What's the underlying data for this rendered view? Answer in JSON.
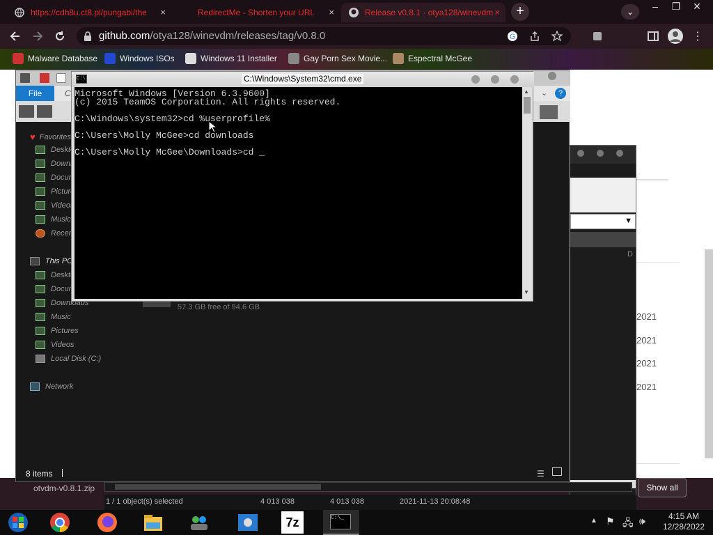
{
  "browser": {
    "tabs": [
      {
        "title": "https://cdh8u.ct8.pl/pungabi/the",
        "close": "×"
      },
      {
        "title": "RedirectMe - Shorten your URL",
        "close": "×"
      },
      {
        "title": "Release v0.8.1 · otya128/winevdm",
        "close": "×"
      }
    ],
    "new_tab": "+",
    "url_host": "github.com",
    "url_path": "/otya128/winevdm/releases/tag/v0.8.0",
    "bookmarks": [
      "Malware Database",
      "Windows ISOs",
      "Windows 11 Installer",
      "Gay Porn Sex Movie...",
      "Espectral McGee"
    ],
    "window_controls": [
      "–",
      "❐",
      "✕"
    ]
  },
  "explorer": {
    "file_tab": "File",
    "partial_tab": "C",
    "favorites_label": "Favorites",
    "favorites": [
      "Desktop",
      "Downloads",
      "Documents",
      "Pictures",
      "Videos",
      "Music",
      "Recent places"
    ],
    "this_pc_label": "This PC",
    "this_pc": [
      "Desktop",
      "Documents",
      "Downloads",
      "Music",
      "Pictures",
      "Videos",
      "Local Disk (C:)"
    ],
    "network_label": "Network",
    "disk_free": "57.3 GB free of 94.6 GB",
    "item_count": "8 items",
    "selection_status": "1 / 1 object(s) selected",
    "size1": "4 013 038",
    "size2": "4 013 038",
    "modified": "2021-11-13 20:08:48"
  },
  "page_fragments": {
    "years": [
      "2021",
      "2021",
      "2021",
      "2021"
    ],
    "show_all": "Show all",
    "download_file": "otvdm-v0.8.1.zip",
    "col_letter": "D"
  },
  "cmd": {
    "title": "C:\\Windows\\System32\\cmd.exe",
    "lines": [
      "Microsoft Windows [Version 6.3.9600]",
      "(c) 2015 TeamOS Corporation. All rights reserved.",
      "",
      "C:\\Windows\\system32>cd %userprofile%",
      "",
      "C:\\Users\\Molly McGee>cd downloads",
      "",
      "C:\\Users\\Molly McGee\\Downloads>cd _"
    ]
  },
  "taskbar": {
    "time": "4:15 AM",
    "date": "12/28/2022",
    "seven_zip": "7z"
  },
  "colors": {
    "tab_text": "#e23030",
    "file_tab": "#1979ca",
    "console_bg": "#000000"
  }
}
